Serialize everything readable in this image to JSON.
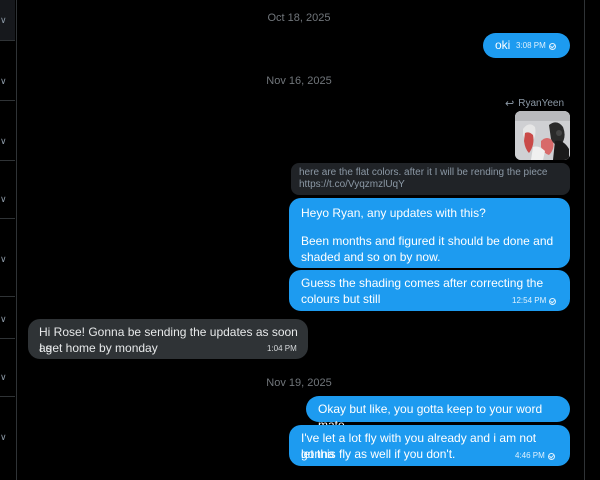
{
  "dates": {
    "d1": "Oct 18, 2025",
    "d2": "Nov 16, 2025",
    "d3": "Nov 19, 2025"
  },
  "forward": {
    "author": "RyanYeen",
    "icon": "reply-arrow-icon"
  },
  "messages": [
    {
      "text": "oki",
      "time": "3:08 PM"
    },
    {
      "text": "here are the flat colors. after it I will be rending the piece",
      "link": "https://t.co/VyqzmzlUqY"
    },
    {
      "line1": "Heyo Ryan, any updates with this?",
      "line2": "Been months and figured it should be done and",
      "line3": "shaded and so on by now."
    },
    {
      "line1": "Guess the shading comes after correcting the",
      "line2": "colours but still",
      "time": "12:54 PM"
    },
    {
      "line1": "Hi Rose! Gonna be sending the updates as soon as",
      "line2": "I get home by monday",
      "time": "1:04 PM"
    },
    {
      "text": "Okay but like, you gotta keep to your word mate"
    },
    {
      "line1": "I've let a lot fly with you already and i am not gonna",
      "line2": "let this fly as well if you don't.",
      "time": "4:46 PM"
    }
  ],
  "colors": {
    "background": "#000000",
    "outgoing_bubble": "#1d9bf0",
    "incoming_bubble": "#2f3336",
    "muted_text": "#71767b"
  }
}
